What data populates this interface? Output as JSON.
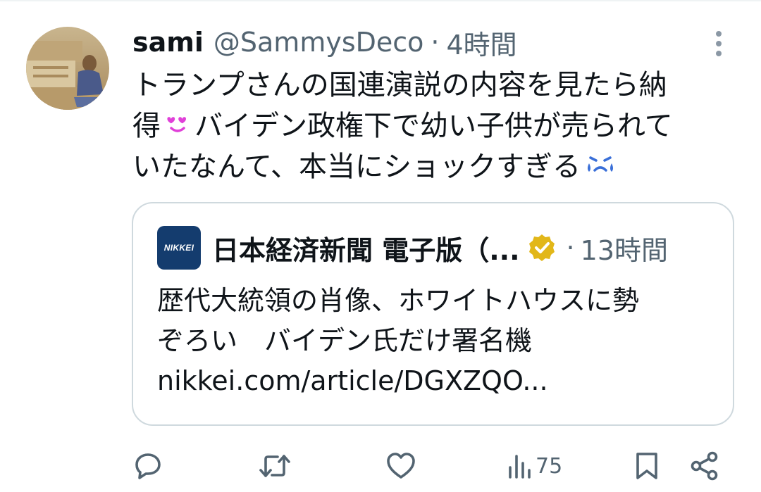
{
  "tweet": {
    "display_name": "sami",
    "handle": "@SammysDeco",
    "separator": "·",
    "time": "4時間",
    "text_line1": "トランプさんの国連演説の内容を見たら納",
    "text_line2_a": "得",
    "text_line2_b": "バイデン政権下で幼い子供が売られて",
    "text_line3": "いたなんて、本当にショックすぎる",
    "emoji_1": "heart-eyes-emoji",
    "emoji_2": "crying-emoji"
  },
  "quote": {
    "avatar_text": "NIKKEI",
    "name": "日本経済新聞 電子版（...",
    "separator": "·",
    "time": "13時間",
    "text_line1": "歴代大統領の肖像、ホワイトハウスに勢",
    "text_line2": "ぞろい　バイデン氏だけ署名機",
    "text_line3": "nikkei.com/article/DGXZQO..."
  },
  "actions": {
    "views": "75",
    "icons": [
      "reply-icon",
      "retweet-icon",
      "like-icon",
      "views-icon",
      "bookmark-icon",
      "share-icon"
    ]
  },
  "colors": {
    "text_primary": "#0f1419",
    "text_secondary": "#536471",
    "border": "#cfd9de",
    "verified_gold": "#e2b719",
    "nikkei_blue": "#143c6e",
    "emoji_pink": "#e040d8"
  }
}
